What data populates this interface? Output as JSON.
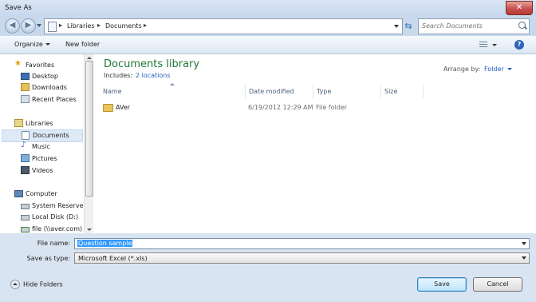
{
  "window": {
    "title": "Save As",
    "close_label": "✕"
  },
  "address": {
    "crumbs": [
      "Libraries",
      "Documents"
    ]
  },
  "search": {
    "placeholder": "Search Documents"
  },
  "toolbar": {
    "organize": "Organize",
    "new_folder": "New folder"
  },
  "sidebar": {
    "items": [
      {
        "label": "Favorites",
        "icon": "star-icon",
        "type": "group"
      },
      {
        "label": "Desktop",
        "icon": "desktop-icon"
      },
      {
        "label": "Downloads",
        "icon": "downloads-icon"
      },
      {
        "label": "Recent Places",
        "icon": "recent-places-icon"
      },
      {
        "label": "Libraries",
        "icon": "libraries-icon",
        "type": "group"
      },
      {
        "label": "Documents",
        "icon": "documents-icon",
        "selected": true
      },
      {
        "label": "Music",
        "icon": "music-icon"
      },
      {
        "label": "Pictures",
        "icon": "pictures-icon"
      },
      {
        "label": "Videos",
        "icon": "videos-icon"
      },
      {
        "label": "Computer",
        "icon": "computer-icon",
        "type": "group"
      },
      {
        "label": "System Reserved",
        "icon": "drive-icon"
      },
      {
        "label": "Local Disk (D:)",
        "icon": "drive-icon"
      },
      {
        "label": "file (\\\\aver.com)",
        "icon": "network-drive-icon"
      }
    ]
  },
  "library": {
    "title": "Documents library",
    "includes_label": "Includes:",
    "includes_link": "2 locations",
    "arrange_label": "Arrange by:",
    "arrange_value": "Folder"
  },
  "columns": [
    "Name",
    "Date modified",
    "Type",
    "Size"
  ],
  "files": [
    {
      "name": "AVer",
      "date": "6/19/2012 12:29 AM",
      "type": "File folder",
      "size": ""
    }
  ],
  "form": {
    "file_name_label": "File name:",
    "file_name_value": "Question sample",
    "save_type_label": "Save as type:",
    "save_type_value": "Microsoft Excel (*.xls)"
  },
  "footer": {
    "hide_folders": "Hide Folders",
    "save": "Save",
    "cancel": "Cancel"
  },
  "colors": {
    "accent_green": "#1d7a34",
    "link_blue": "#1f5fbf",
    "selection": "#3399ff"
  }
}
